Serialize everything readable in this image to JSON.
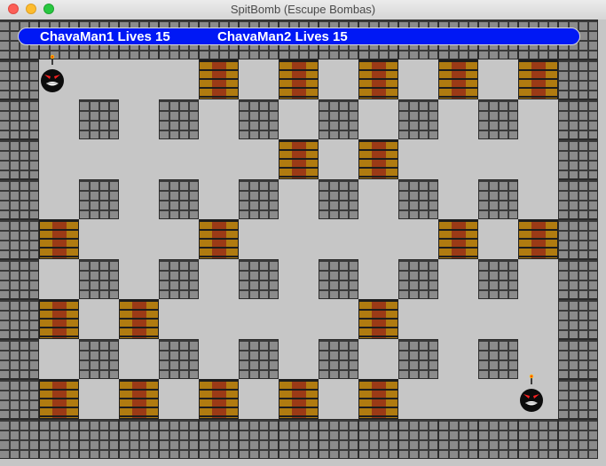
{
  "window": {
    "title": "SpitBomb (Escupe Bombas)"
  },
  "hud": {
    "player1": "ChavaMan1 Lives 15",
    "player2": "ChavaMan2 Lives 15"
  },
  "board": {
    "cols": 15,
    "rows": 11,
    "wall_color": "#8b8b8b",
    "brick_color": "#9b3a16",
    "floor_color": "#c6c6c6",
    "bricks": [
      [
        1,
        5
      ],
      [
        1,
        7
      ],
      [
        1,
        9
      ],
      [
        1,
        11
      ],
      [
        1,
        13
      ],
      [
        3,
        7
      ],
      [
        3,
        9
      ],
      [
        5,
        1
      ],
      [
        5,
        5
      ],
      [
        5,
        11
      ],
      [
        5,
        13
      ],
      [
        7,
        1
      ],
      [
        7,
        3
      ],
      [
        7,
        9
      ],
      [
        9,
        1
      ],
      [
        9,
        3
      ],
      [
        9,
        5
      ],
      [
        9,
        7
      ],
      [
        9,
        9
      ]
    ]
  },
  "players": [
    {
      "name": "ChavaMan1",
      "row": 1,
      "col": 1
    },
    {
      "name": "ChavaMan2",
      "row": 9,
      "col": 13
    }
  ]
}
